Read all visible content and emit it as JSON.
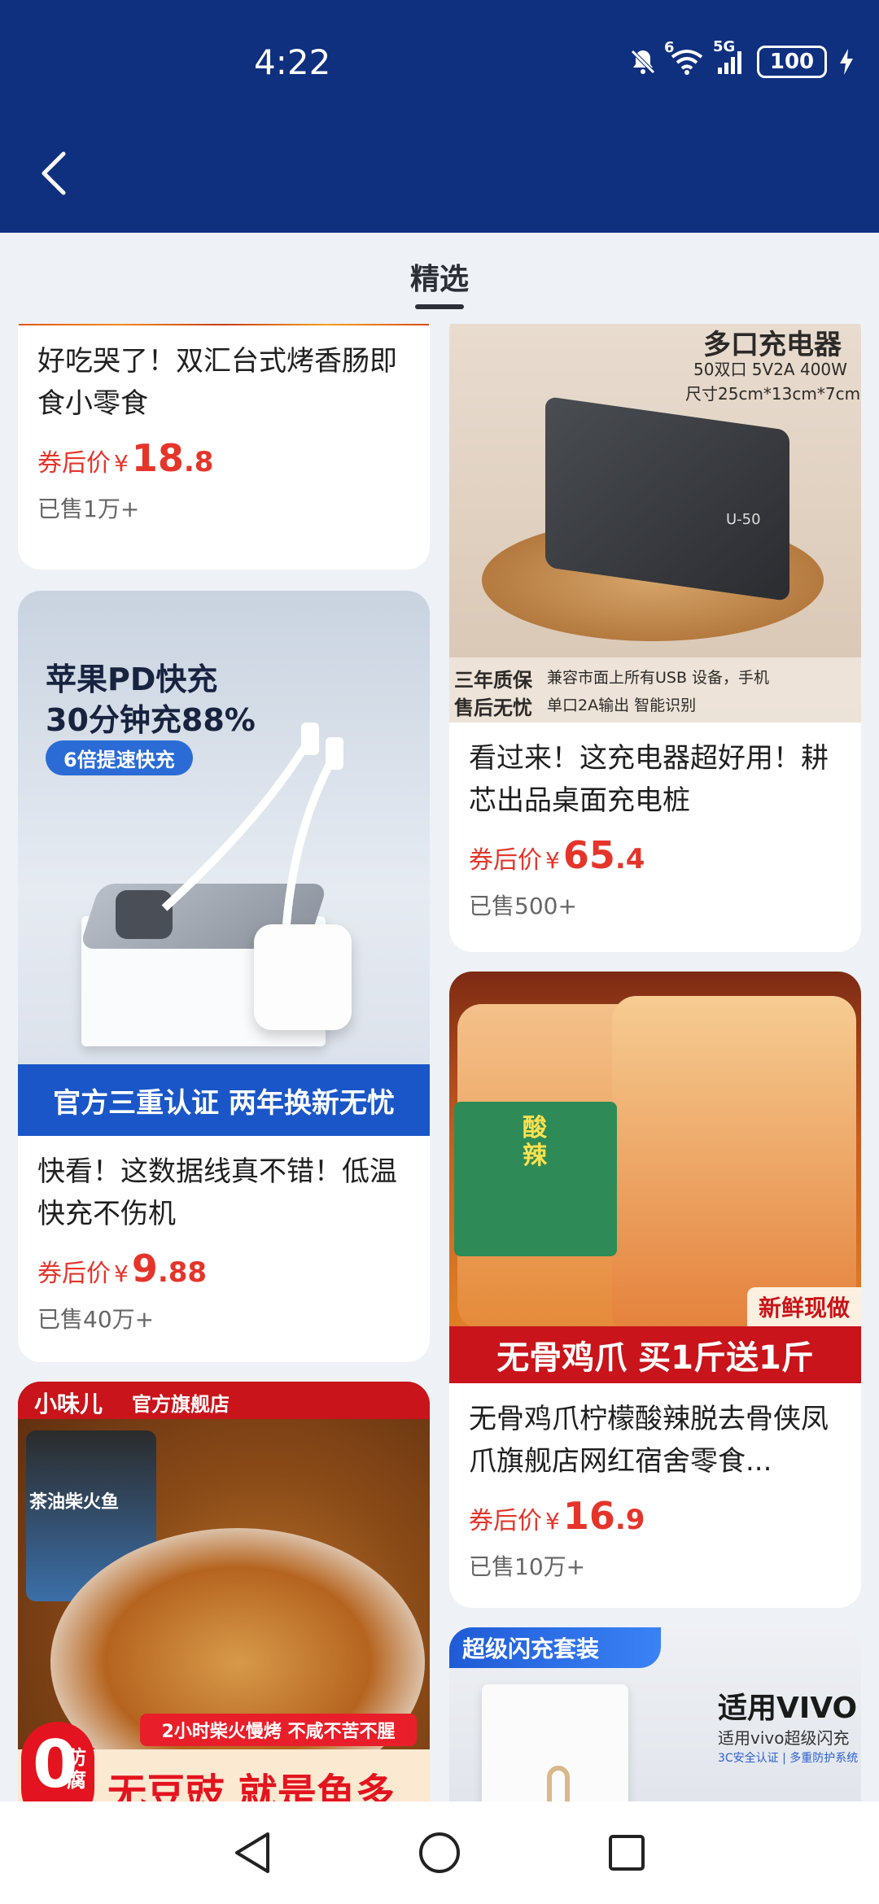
{
  "status": {
    "time": "4:22",
    "battery": "100",
    "wifi_badge": "6",
    "network": "5G"
  },
  "tab": {
    "label": "精选"
  },
  "colors": {
    "header": "#0f2f7f",
    "price": "#e5352b"
  },
  "products": [
    {
      "title": "好吃哭了！双汇台式烤香肠即食小零食",
      "price_label": "券后价",
      "currency": "¥",
      "price_int": "18",
      "price_dec": ".8",
      "sold": "已售1万+"
    },
    {
      "title": "看过来！这充电器超好用！耕芯出品桌面充电桩",
      "price_label": "券后价",
      "currency": "¥",
      "price_int": "65",
      "price_dec": ".4",
      "sold": "已售500+",
      "image_text": {
        "headline": "多口充电器",
        "spec1": "50双口 5V2A 400W",
        "spec2": "尺寸25cm*13cm*7cm",
        "model": "U-50",
        "badge1": "三年质保",
        "badge2": "售后无忧",
        "note1": "兼容市面上所有USB 设备，手机",
        "note2": "单口2A输出 智能识别"
      }
    },
    {
      "title": "快看！这数据线真不错！低温快充不伤机",
      "price_label": "券后价",
      "currency": "¥",
      "price_int": "9",
      "price_dec": ".88",
      "sold": "已售40万+",
      "image_text": {
        "headline1": "苹果PD快充",
        "headline2": "30分钟充88%",
        "pill": "6倍提速快充",
        "footer": "官方三重认证  两年换新无忧"
      }
    },
    {
      "title": "无骨鸡爪柠檬酸辣脱去骨侠凤爪旗舰店网红宿舍零食...",
      "price_label": "券后价",
      "currency": "¥",
      "price_int": "16",
      "price_dec": ".9",
      "sold": "已售10万+",
      "image_text": {
        "badge": "新鲜现做",
        "footer": "无骨鸡爪  买1斤送1斤",
        "jar": "酸辣"
      }
    },
    {
      "image_text": {
        "brand": "小味儿",
        "store": "官方旗舰店",
        "jar_label": "茶油柴火鱼",
        "banner": "2小时柴火慢烤 不咸不苦不腥",
        "zero": "0",
        "zero_sub": "防腐",
        "slogan": "无豆豉 就是鱼多"
      }
    },
    {
      "image_text": {
        "tag": "超级闪充套装",
        "headline": "适用VIVO",
        "sub": "适用vivo超级闪充",
        "note": "3C安全认证 | 多重防护系统"
      }
    }
  ]
}
